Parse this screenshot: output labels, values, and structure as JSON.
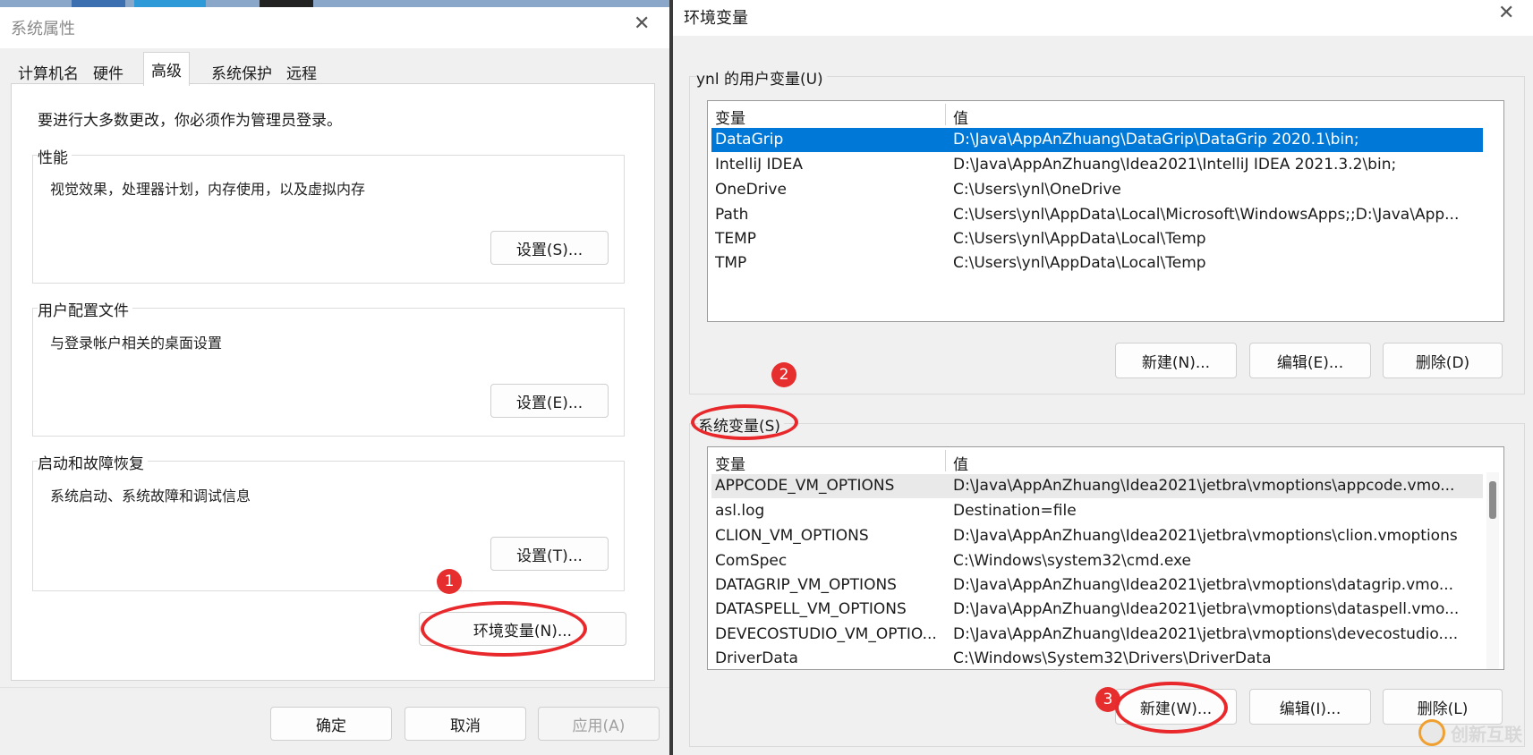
{
  "system_properties": {
    "title": "系统属性",
    "tabs": [
      "计算机名",
      "硬件",
      "高级",
      "系统保护",
      "远程"
    ],
    "active_tab": "高级",
    "notice": "要进行大多数更改，你必须作为管理员登录。",
    "performance": {
      "label": "性能",
      "desc": "视觉效果，处理器计划，内存使用，以及虚拟内存",
      "button": "设置(S)..."
    },
    "user_profiles": {
      "label": "用户配置文件",
      "desc": "与登录帐户相关的桌面设置",
      "button": "设置(E)..."
    },
    "startup_recovery": {
      "label": "启动和故障恢复",
      "desc": "系统启动、系统故障和调试信息",
      "button": "设置(T)..."
    },
    "env_button": "环境变量(N)...",
    "footer": {
      "ok": "确定",
      "cancel": "取消",
      "apply": "应用(A)"
    }
  },
  "env_vars": {
    "title": "环境变量",
    "user_section_label": "ynl 的用户变量(U)",
    "system_section_label": "系统变量(S)",
    "col_var": "变量",
    "col_val": "值",
    "user_vars": [
      {
        "name": "DataGrip",
        "value": "D:\\Java\\AppAnZhuang\\DataGrip\\DataGrip 2020.1\\bin;"
      },
      {
        "name": "IntelliJ IDEA",
        "value": "D:\\Java\\AppAnZhuang\\Idea2021\\IntelliJ IDEA 2021.3.2\\bin;"
      },
      {
        "name": "OneDrive",
        "value": "C:\\Users\\ynl\\OneDrive"
      },
      {
        "name": "Path",
        "value": "C:\\Users\\ynl\\AppData\\Local\\Microsoft\\WindowsApps;;D:\\Java\\App..."
      },
      {
        "name": "TEMP",
        "value": "C:\\Users\\ynl\\AppData\\Local\\Temp"
      },
      {
        "name": "TMP",
        "value": "C:\\Users\\ynl\\AppData\\Local\\Temp"
      }
    ],
    "system_vars": [
      {
        "name": "APPCODE_VM_OPTIONS",
        "value": "D:\\Java\\AppAnZhuang\\Idea2021\\jetbra\\vmoptions\\appcode.vmo..."
      },
      {
        "name": "asl.log",
        "value": "Destination=file"
      },
      {
        "name": "CLION_VM_OPTIONS",
        "value": "D:\\Java\\AppAnZhuang\\Idea2021\\jetbra\\vmoptions\\clion.vmoptions"
      },
      {
        "name": "ComSpec",
        "value": "C:\\Windows\\system32\\cmd.exe"
      },
      {
        "name": "DATAGRIP_VM_OPTIONS",
        "value": "D:\\Java\\AppAnZhuang\\Idea2021\\jetbra\\vmoptions\\datagrip.vmo..."
      },
      {
        "name": "DATASPELL_VM_OPTIONS",
        "value": "D:\\Java\\AppAnZhuang\\Idea2021\\jetbra\\vmoptions\\dataspell.vmo..."
      },
      {
        "name": "DEVECOSTUDIO_VM_OPTIO...",
        "value": "D:\\Java\\AppAnZhuang\\Idea2021\\jetbra\\vmoptions\\devecostudio...."
      },
      {
        "name": "DriverData",
        "value": "C:\\Windows\\System32\\Drivers\\DriverData"
      }
    ],
    "user_buttons": {
      "new": "新建(N)...",
      "edit": "编辑(E)...",
      "delete": "删除(D)"
    },
    "system_buttons": {
      "new": "新建(W)...",
      "edit": "编辑(I)...",
      "delete": "删除(L)"
    }
  },
  "annotations": {
    "step1": "1",
    "step2": "2",
    "step3": "3"
  },
  "watermark": {
    "text": "创新互联"
  },
  "colors": {
    "selection": "#0078d7",
    "annotation": "#e62e2e"
  }
}
